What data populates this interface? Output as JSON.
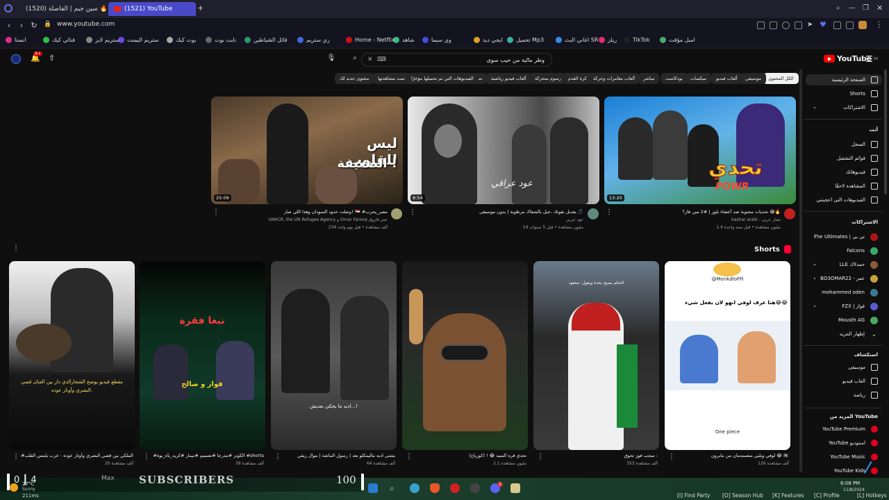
{
  "browser": {
    "tabs": [
      {
        "label": "(1520) سين جيم | الفاصلة 🔥",
        "active": false
      },
      {
        "label": "(1521) YouTube",
        "active": true
      }
    ],
    "new_tab_label": "+",
    "url": "www.youtube.com",
    "bookmarks": [
      "امبل مؤقت",
      "TikTok",
      "ريلز",
      "اغاني البث SR",
      "تحميل Mp3",
      "ايجي ديد",
      "وي سيما",
      "شاهد",
      "Home - Netflix",
      "ري ستريم",
      "قائل الشياطين",
      "نايت بوت",
      "بوت كيك",
      "ستريم اليمنت",
      "ستريم لايز",
      "قنائي كيك",
      "انستا"
    ]
  },
  "youtube": {
    "logo_text": "YouTube",
    "logo_badge": "SA",
    "search_value": "وطر مالية من حيب سوى",
    "notification_count": "9+",
    "chips": [
      "الكل المحتوى",
      "موسيقى",
      "ألعاب فيديو",
      "ميكسات",
      "بودكاست",
      "مباشر",
      "ألعاب مغامرات وحركة",
      "كرة القدم",
      "رسوم متحركة",
      "ألعاب فيديو رياضية",
      "سياسة",
      "الفيديوهات التي تم تحميلها مؤخرًا",
      "تمت مشاهدتها",
      "محتوى جديد لك"
    ],
    "sidebar": {
      "main": [
        {
          "label": "الصفحة الرئيسية",
          "icon": "home-icon",
          "active": true
        },
        {
          "label": "Shorts",
          "icon": "shorts-icon"
        },
        {
          "label": "الاشتراكات",
          "icon": "subscriptions-icon"
        }
      ],
      "you_header": "أنت",
      "you": [
        {
          "label": "السجل",
          "icon": "history-icon"
        },
        {
          "label": "قوائم التشغيل",
          "icon": "playlist-icon"
        },
        {
          "label": "فيديوهاتك",
          "icon": "your-videos-icon"
        },
        {
          "label": "المشاهدة لاحقًا",
          "icon": "watch-later-icon"
        },
        {
          "label": "الفيديوهات التي أعجبتني",
          "icon": "like-icon"
        }
      ],
      "subs_header": "الاشتراكات",
      "subs": [
        {
          "label": "The Ultimates | تي بي",
          "color": "#b01515"
        },
        {
          "label": "Falcons",
          "color": "#3ba86b"
        },
        {
          "label": "LLE حمدلاك",
          "color": "#8d5b3a"
        },
        {
          "label": "BO3OMAR22 - عمر",
          "color": "#c7a23a"
        },
        {
          "label": "mohammed oden",
          "color": "#3a7a8d"
        },
        {
          "label": "FZX | فواز",
          "color": "#5a5ad0"
        },
        {
          "label": "Mousth AG",
          "color": "#4aa860"
        },
        {
          "label": "إظهار المزيد",
          "color": ""
        }
      ],
      "explore_header": "استكشاف",
      "explore": [
        {
          "label": "موسيقى",
          "icon": "music-icon"
        },
        {
          "label": "ألعاب فيديو",
          "icon": "gaming-icon"
        },
        {
          "label": "رياضة",
          "icon": "sports-icon"
        }
      ],
      "more_header": "المزيد من YouTube",
      "more": [
        "YouTube Premium",
        "YouTube استوديو",
        "YouTube Music",
        "YouTube Kids"
      ]
    },
    "videos": [
      {
        "title": "تحديات مجنونة ضد أعضاء بلوز | #2 مين فاز؟ 😂🔥",
        "channel": "bashar arabi - بشار عربي",
        "views": "1.4 مليون مشاهدة",
        "age": "قبل سنة واحدة",
        "duration": "13:20",
        "overlay": "تحدي",
        "overlay2": "POWR"
      },
      {
        "title": "بعديل بقوتك ،خيل بالشفاك مرطوبة | بدون موسيقى 🎵",
        "channel": "عود عربي",
        "views": "14 مليون مشاهدة",
        "age": "قبل 5 سنوات",
        "duration": "8:54",
        "overlay": "عود عراقي"
      },
      {
        "title": "وصلت حدود السودان وهذا اللي صار! 🇸🇩 #مصر_يحرب",
        "channel": "Omar Farooq عمر فاروق",
        "channel2": "UNHCR, the UN Refugee Agency",
        "views": "234 ألف مشاهدة",
        "age": "قبل يوم واحد",
        "duration": "25:09",
        "overlay": "ليس للقلوب",
        "overlay2": "الضعيفة !"
      }
    ],
    "shorts_header": "Shorts",
    "shorts": [
      {
        "title": "لوفي وبلبي متصمدمان من مابرون 😂 🏴‍☠️",
        "views": "126 ألف مشاهدة",
        "top_user": "@MonkdloFFi",
        "caption": "هنا عرف لوفي انهو لان يفعل شيء😂😂",
        "bottom": "One piece"
      },
      {
        "title": "سجب فوز تحوق :",
        "views": "353 ألف مشاهدة",
        "caption": "الحكم يصيح بحدة ويقول: ستعود"
      },
      {
        "title": "تحدي قره السيد 😂 ! (كورياج)",
        "views": "2.1 مليون مشاهدة",
        "caption": ""
      },
      {
        "title": "يشتي ادبه ماليمكلو بعد | رسول الماشة | موال ريفي",
        "views": "64 ألف مشاهدة",
        "caption": "اديه ما يحكي بعديش...!"
      },
      {
        "title": "#الكوتر #مدرجا #تصميم #نيمار #كريد_بأة_بوة #shorts",
        "views": "39 ألف مشاهدة",
        "caption": "فواز و صالح",
        "overlay": "نبغا فقرة"
      },
      {
        "title": "#الشجار الملكي بين قصي البصري وأوتار عوده - عرب يلمس القلب 💔",
        "views": "20 ألف مشاهدة",
        "caption": "مقطع فيديو يوضح الشجارالذي دار بين الفنان قصي البصري وأوتار عوده."
      }
    ]
  },
  "taskbar": {
    "stream_left": "0 ┃ 4",
    "stream_max": "Max",
    "stream_subs": "SUBSCRIBERS",
    "stream_num": "100",
    "weather": "27°C",
    "weather_sub": "Sunny",
    "fps": "211ms",
    "clock": "6:08 PM",
    "date": "11/8/2024",
    "hotkeys": [
      "[I] Find Party",
      "[O] Season Hub",
      "[K] Features",
      "[C] Profile",
      "[L] Hotkeys"
    ],
    "notif_badge": "1"
  }
}
